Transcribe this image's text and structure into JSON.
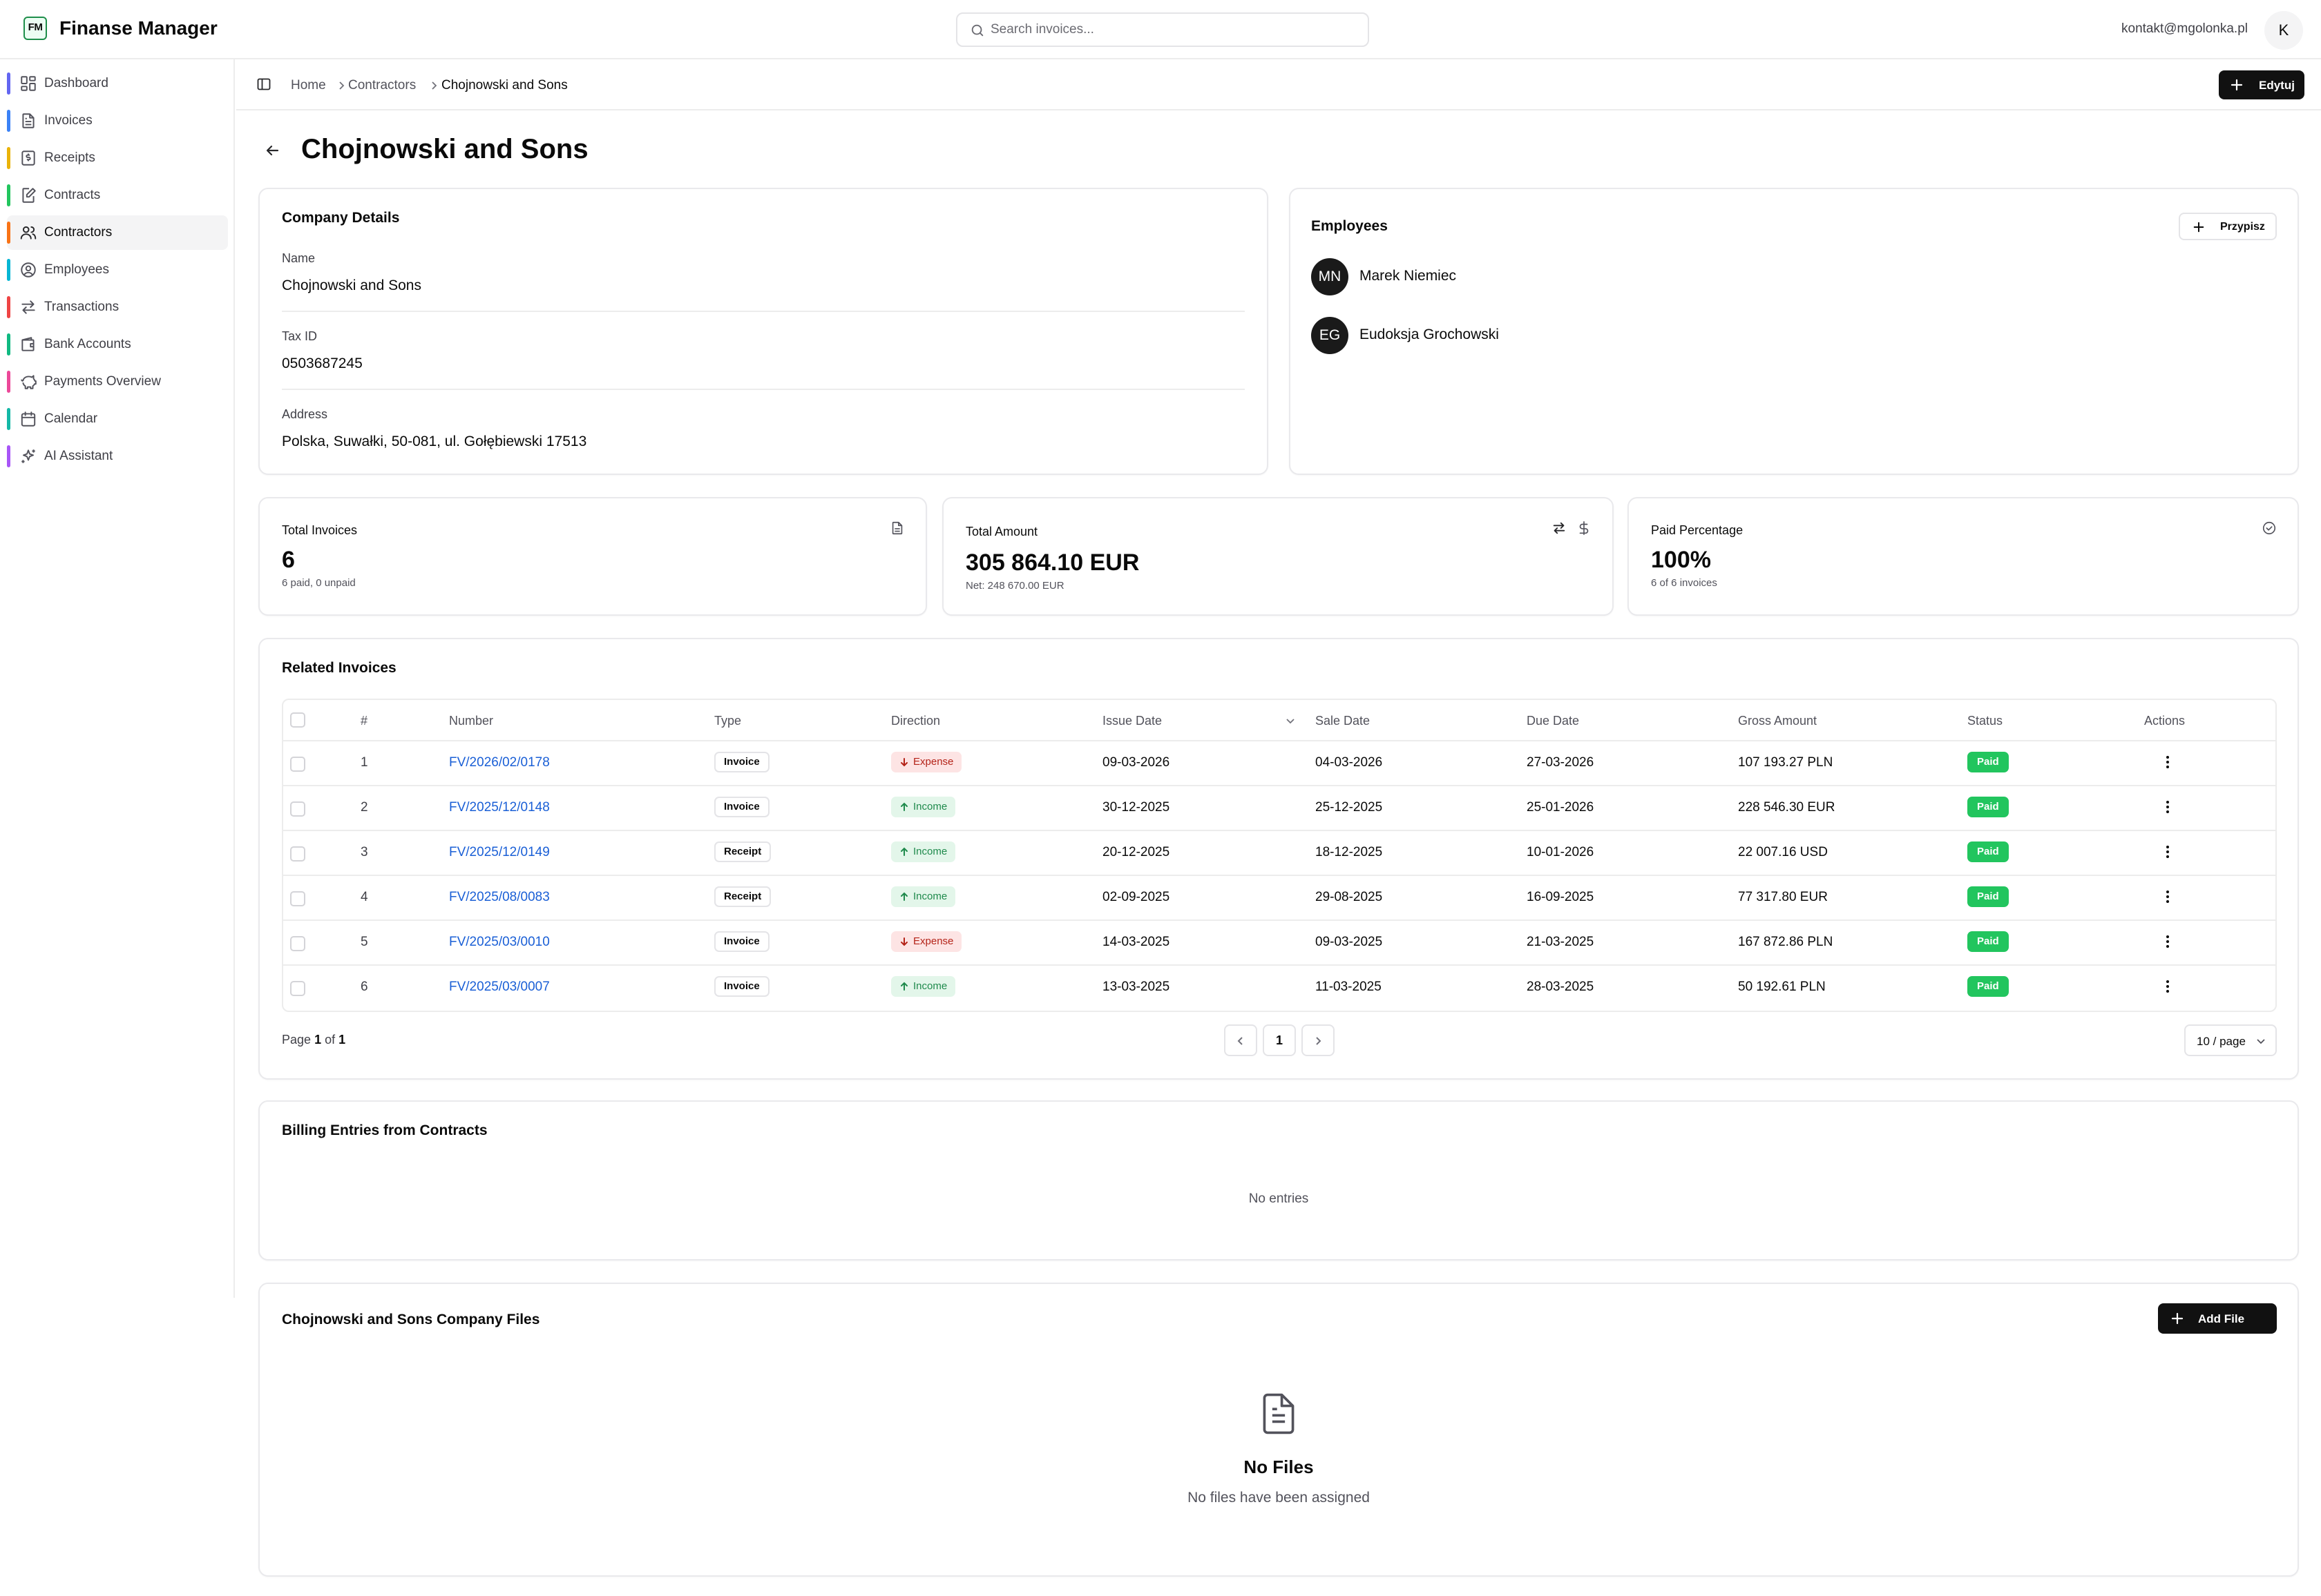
{
  "app": {
    "logo_text": "FM",
    "title": "Finanse Manager"
  },
  "search": {
    "placeholder": "Search invoices..."
  },
  "user": {
    "email": "kontakt@mgolonka.pl",
    "initial": "K"
  },
  "colors": {
    "accent": "#111111",
    "link": "#1a5fd6",
    "paid": "#22c55e",
    "expense_bg": "#fde4e4",
    "income_bg": "#e3f6ea"
  },
  "sidebar": {
    "items": [
      {
        "label": "Dashboard",
        "icon": "dashboard-icon",
        "color": "#6366f1"
      },
      {
        "label": "Invoices",
        "icon": "file-text-icon",
        "color": "#3b82f6"
      },
      {
        "label": "Receipts",
        "icon": "receipt-icon",
        "color": "#eab308"
      },
      {
        "label": "Contracts",
        "icon": "contract-icon",
        "color": "#22c55e"
      },
      {
        "label": "Contractors",
        "icon": "users-icon",
        "color": "#f97316"
      },
      {
        "label": "Employees",
        "icon": "user-circle-icon",
        "color": "#06b6d4"
      },
      {
        "label": "Transactions",
        "icon": "transfer-icon",
        "color": "#ef4444"
      },
      {
        "label": "Bank Accounts",
        "icon": "wallet-icon",
        "color": "#10b981"
      },
      {
        "label": "Payments Overview",
        "icon": "piggy-bank-icon",
        "color": "#ec4899"
      },
      {
        "label": "Calendar",
        "icon": "calendar-icon",
        "color": "#14b8a6"
      },
      {
        "label": "AI Assistant",
        "icon": "sparkles-icon",
        "color": "#a855f7"
      }
    ]
  },
  "breadcrumb": [
    "Home",
    "Contractors",
    "Chojnowski and Sons"
  ],
  "header": {
    "edit_label": "Edytuj",
    "title": "Chojnowski and Sons"
  },
  "company": {
    "section_title": "Company Details",
    "name_label": "Name",
    "name": "Chojnowski and Sons",
    "tax_label": "Tax ID",
    "tax_id": "0503687245",
    "address_label": "Address",
    "address": "Polska, Suwałki, 50-081, ul. Gołębiewski 17513"
  },
  "employees": {
    "section_title": "Employees",
    "assign_label": "Przypisz",
    "list": [
      {
        "initials": "MN",
        "name": "Marek Niemiec"
      },
      {
        "initials": "EG",
        "name": "Eudoksja Grochowski"
      }
    ]
  },
  "stats": {
    "total_invoices": {
      "label": "Total Invoices",
      "value": "6",
      "sub": "6 paid, 0 unpaid"
    },
    "total_amount": {
      "label": "Total Amount",
      "value": "305 864.10 EUR",
      "sub": "Net: 248 670.00 EUR"
    },
    "paid_percentage": {
      "label": "Paid Percentage",
      "value": "100%",
      "sub": "6 of 6 invoices"
    }
  },
  "invoices": {
    "section_title": "Related Invoices",
    "columns": [
      "#",
      "Number",
      "Type",
      "Direction",
      "Issue Date",
      "Sale Date",
      "Due Date",
      "Gross Amount",
      "Status",
      "Actions"
    ],
    "rows": [
      {
        "n": "1",
        "number": "FV/2026/02/0178",
        "type": "Invoice",
        "direction": "Expense",
        "issue": "09-03-2026",
        "sale": "04-03-2026",
        "due": "27-03-2026",
        "gross": "107 193.27 PLN",
        "status": "Paid"
      },
      {
        "n": "2",
        "number": "FV/2025/12/0148",
        "type": "Invoice",
        "direction": "Income",
        "issue": "30-12-2025",
        "sale": "25-12-2025",
        "due": "25-01-2026",
        "gross": "228 546.30 EUR",
        "status": "Paid"
      },
      {
        "n": "3",
        "number": "FV/2025/12/0149",
        "type": "Receipt",
        "direction": "Income",
        "issue": "20-12-2025",
        "sale": "18-12-2025",
        "due": "10-01-2026",
        "gross": "22 007.16 USD",
        "status": "Paid"
      },
      {
        "n": "4",
        "number": "FV/2025/08/0083",
        "type": "Receipt",
        "direction": "Income",
        "issue": "02-09-2025",
        "sale": "29-08-2025",
        "due": "16-09-2025",
        "gross": "77 317.80 EUR",
        "status": "Paid"
      },
      {
        "n": "5",
        "number": "FV/2025/03/0010",
        "type": "Invoice",
        "direction": "Expense",
        "issue": "14-03-2025",
        "sale": "09-03-2025",
        "due": "21-03-2025",
        "gross": "167 872.86 PLN",
        "status": "Paid"
      },
      {
        "n": "6",
        "number": "FV/2025/03/0007",
        "type": "Invoice",
        "direction": "Income",
        "issue": "13-03-2025",
        "sale": "11-03-2025",
        "due": "28-03-2025",
        "gross": "50 192.61 PLN",
        "status": "Paid"
      }
    ],
    "pagination": {
      "prefix": "Page",
      "current": "1",
      "of_word": "of",
      "total": "1",
      "page_button": "1",
      "page_size": "10 / page"
    }
  },
  "billing": {
    "section_title": "Billing Entries from Contracts",
    "empty": "No entries"
  },
  "files": {
    "section_title": "Chojnowski and Sons Company Files",
    "add_label": "Add File",
    "empty_title": "No Files",
    "empty_sub": "No files have been assigned"
  }
}
